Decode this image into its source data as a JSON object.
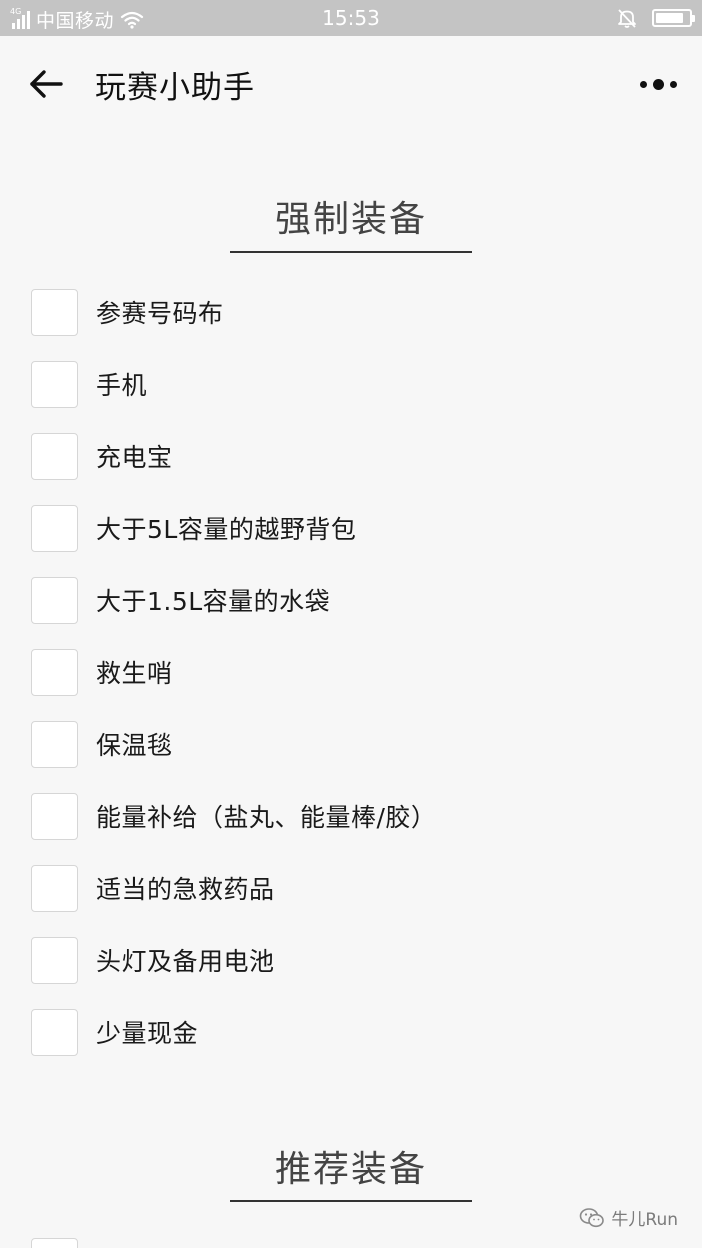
{
  "status_bar": {
    "network": "4G",
    "carrier": "中国移动",
    "time": "15:53",
    "battery_level": 0.85,
    "color": "#c4c4c4"
  },
  "nav": {
    "title": "玩赛小助手",
    "back_icon": "arrow-left-icon",
    "more_icon": "more-dots-icon"
  },
  "mandatory": {
    "title": "强制装备",
    "items": [
      {
        "label": "参赛号码布",
        "checked": false
      },
      {
        "label": "手机",
        "checked": false
      },
      {
        "label": "充电宝",
        "checked": false
      },
      {
        "label": "大于5L容量的越野背包",
        "checked": false
      },
      {
        "label": "大于1.5L容量的水袋",
        "checked": false
      },
      {
        "label": "救生哨",
        "checked": false
      },
      {
        "label": "保温毯",
        "checked": false
      },
      {
        "label": "能量补给（盐丸、能量棒/胶）",
        "checked": false
      },
      {
        "label": "适当的急救药品",
        "checked": false
      },
      {
        "label": "头灯及备用电池",
        "checked": false
      },
      {
        "label": "少量现金",
        "checked": false
      }
    ]
  },
  "recommended": {
    "title": "推荐装备"
  },
  "watermark": {
    "text": "牛儿Run",
    "icon": "wechat-icon"
  }
}
